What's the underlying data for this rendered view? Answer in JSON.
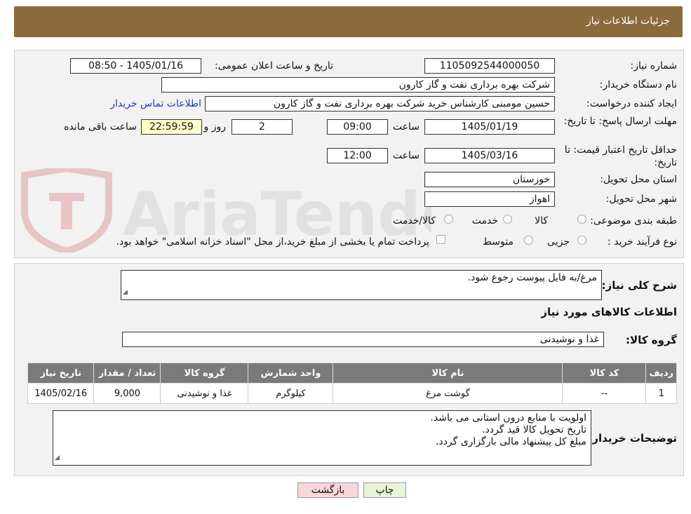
{
  "header": {
    "title": "جزئیات اطلاعات نیاز"
  },
  "form": {
    "need_number_label": "شماره نیاز:",
    "need_number": "1105092544000050",
    "announce_label": "تاریخ و ساعت اعلان عمومی:",
    "announce_value": "1405/01/16 - 08:50",
    "buyer_org_label": "نام دستگاه خریدار:",
    "buyer_org": "شرکت بهره برداری نفت و گاز کارون",
    "creator_label": "ایجاد کننده درخواست:",
    "creator": "حسین مومبنی کارشناس خرید شرکت بهره برداری نفت و گاز کارون",
    "contact_link": "اطلاعات تماس خریدار",
    "deadline_label": "مهلت ارسال پاسخ: تا تاریخ:",
    "deadline_date": "1405/01/19",
    "time_label": "ساعت",
    "deadline_time": "09:00",
    "days_value": "2",
    "days_label": "روز و",
    "remaining_time": "22:59:59",
    "remaining_label": "ساعت باقی مانده",
    "validity_label": "حداقل تاریخ اعتبار قیمت: تا تاریخ:",
    "validity_date": "1405/03/16",
    "validity_time": "12:00",
    "province_label": "استان محل تحویل:",
    "province": "خوزستان",
    "city_label": "شهر محل تحویل:",
    "city": "اهواز",
    "category_label": "طبقه بندی موضوعی:",
    "cat_goods": "کالا",
    "cat_service": "خدمت",
    "cat_both": "کالا/خدمت",
    "process_label": "نوع فرآیند خرید :",
    "proc_partial": "جزیی",
    "proc_medium": "متوسط",
    "payment_note": "پرداخت تمام یا بخشی از مبلغ خرید،از محل \"اسناد خزانه اسلامی\" خواهد بود."
  },
  "details": {
    "summary_label": "شرح کلی نیاز:",
    "summary": "مرغ/به فایل پیوست رجوع شود.",
    "goods_info_title": "اطلاعات کالاهای مورد نیاز",
    "goods_group_label": "گروه کالا:",
    "goods_group": "غذا و نوشیدنی",
    "table": {
      "headers": [
        "ردیف",
        "کد کالا",
        "نام کالا",
        "واحد شمارش",
        "گروه کالا",
        "تعداد / مقدار",
        "تاریخ نیاز"
      ],
      "rows": [
        [
          "1",
          "--",
          "گوشت مرغ",
          "کیلوگرم",
          "غذا و نوشیدنی",
          "9,000",
          "1405/02/16"
        ]
      ]
    },
    "buyer_notes_label": "توضیحات خریدار:",
    "buyer_notes": [
      "اولویت با منابع درون استانی می باشد.",
      "تاریخ تحویل کالا قید گردد.",
      "مبلغ کل پیشنهاد مالی بارگزاری گردد."
    ]
  },
  "buttons": {
    "print": "چاپ",
    "back": "بازگشت"
  },
  "colors": {
    "header_bg": "#8b6a3c",
    "table_header_bg": "#7a7a7a",
    "back_button_bg": "#f8d7d7",
    "print_button_bg": "#e6f4d7"
  }
}
